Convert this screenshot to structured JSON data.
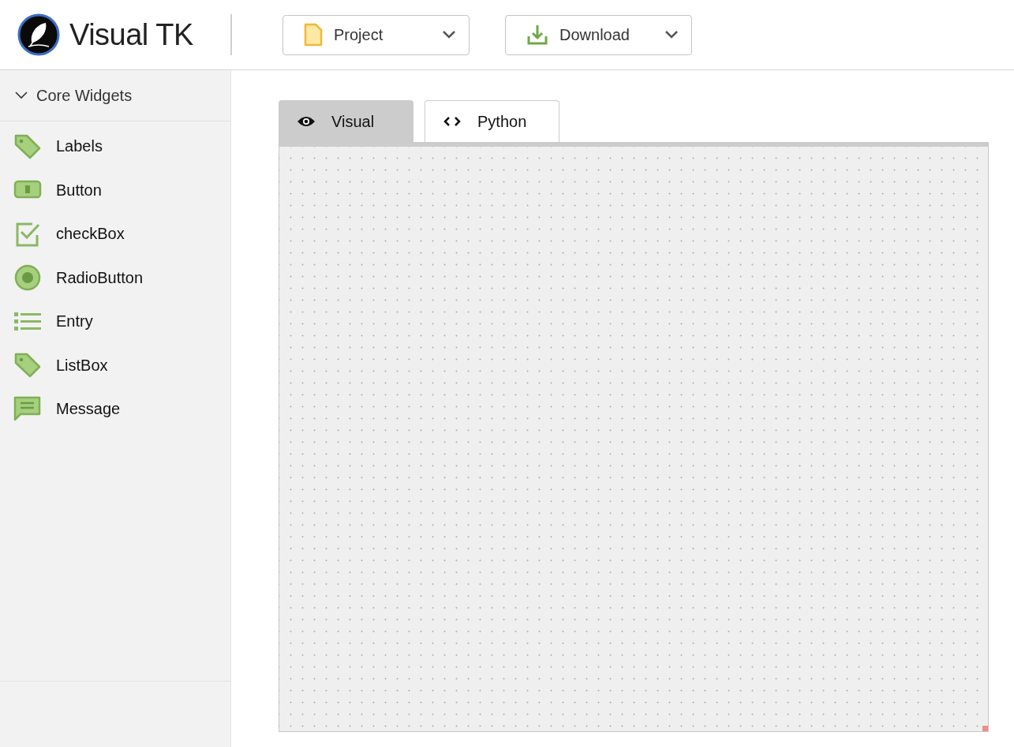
{
  "app": {
    "title": "Visual TK"
  },
  "toolbar": [
    {
      "kind": "project",
      "label": "Project"
    },
    {
      "kind": "download",
      "label": "Download"
    }
  ],
  "sidebar": {
    "section": {
      "title": "Core Widgets",
      "expanded": true
    },
    "items": [
      {
        "kind": "tag",
        "label": "Labels"
      },
      {
        "kind": "button",
        "label": "Button"
      },
      {
        "kind": "check",
        "label": "checkBox"
      },
      {
        "kind": "radio",
        "label": "RadioButton"
      },
      {
        "kind": "list",
        "label": "Entry"
      },
      {
        "kind": "tag",
        "label": "ListBox"
      },
      {
        "kind": "message",
        "label": "Message"
      }
    ]
  },
  "tabs": [
    {
      "kind": "visual",
      "label": "Visual",
      "selected": true
    },
    {
      "kind": "code",
      "label": "Python",
      "selected": false
    }
  ]
}
